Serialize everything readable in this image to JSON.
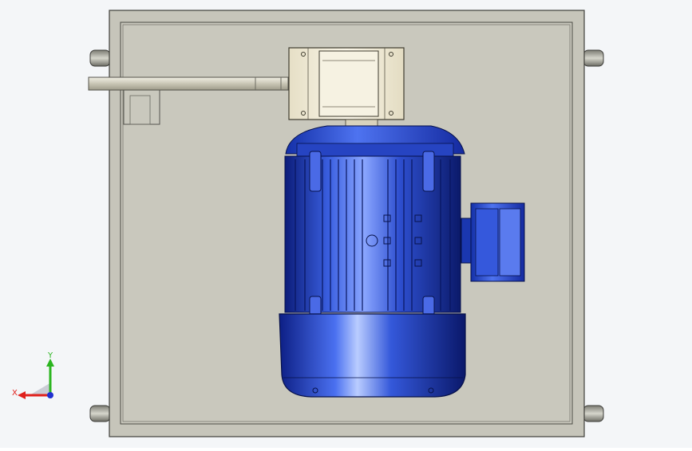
{
  "viewport": {
    "background": "#f4f6f8"
  },
  "model": {
    "plate_color": "#c9c8bd",
    "plate_edge_color": "#4a4a44",
    "motor_color": "#1f3fb5",
    "motor_dark": "#0d1f7a",
    "motor_light": "#6f8ff0",
    "box_color": "#efe9d4",
    "rod_color": "#d8d6c8"
  },
  "triad": {
    "x_label": "X",
    "y_label": "Y",
    "x_color": "#e0201c",
    "y_color": "#2bb51f",
    "z_color": "#2030d0"
  }
}
